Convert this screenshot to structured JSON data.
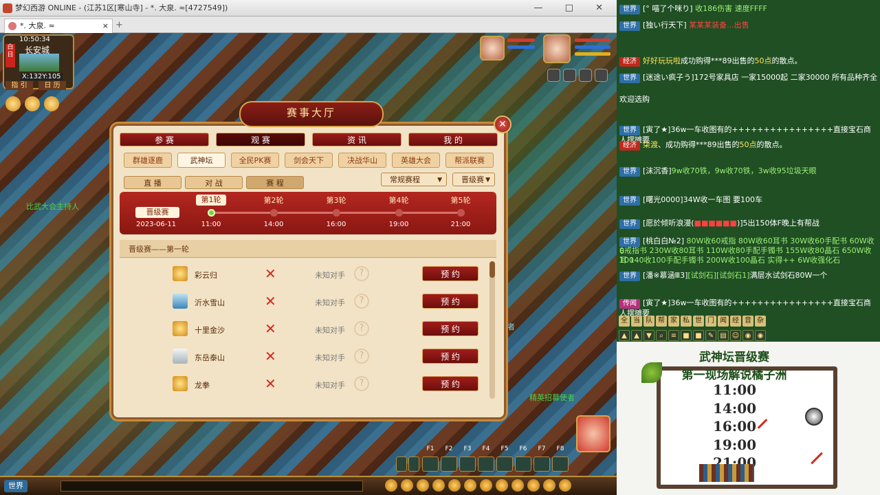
{
  "window": {
    "title": "梦幻西游 ONLINE - (江苏1区[寒山寺] - *. 大泉. ≈[4727549])",
    "controls": "— □ ✕"
  },
  "tab": {
    "title": "*. 大泉. ≈",
    "close": "×",
    "new": "+"
  },
  "minimap": {
    "time": "10:50:34",
    "city": "长安城",
    "coord": "X:132Y:105",
    "day": "白日",
    "guide": "指 引",
    "calendar": "日 历"
  },
  "npc_names": [
    "比武大会主持人",
    "精英招募使者",
    "者"
  ],
  "panel": {
    "title": "赛事大厅",
    "close": "✕",
    "main_tabs": [
      "参 赛",
      "观 赛",
      "资 讯",
      "我 的"
    ],
    "main_selected": 1,
    "sub_tabs": [
      "群雄逐鹿",
      "武神坛",
      "全民PK赛",
      "剑会天下",
      "决战华山",
      "英雄大会",
      "帮派联赛"
    ],
    "sub_selected": 1,
    "view_tabs": [
      "直 播",
      "对 战",
      "赛 程"
    ],
    "view_selected": 2,
    "dropdown_type": "常规赛程",
    "dropdown_stage": "晋级赛",
    "timeline": {
      "label": "晋级赛",
      "date": "2023-06-11",
      "rounds": [
        "第1轮",
        "第2轮",
        "第3轮",
        "第4轮",
        "第5轮"
      ],
      "times": [
        "11:00",
        "14:00",
        "16:00",
        "19:00",
        "21:00"
      ],
      "selected": 0
    },
    "section_title": "晋级赛——第一轮",
    "matches": [
      {
        "server": "彩云归",
        "icon": "dream-icon",
        "opponent": "未知对手",
        "action": "预 约"
      },
      {
        "server": "沂水雪山",
        "icon": "mountain-icon",
        "opponent": "未知对手",
        "action": "预 约"
      },
      {
        "server": "十里金沙",
        "icon": "dream-icon",
        "opponent": "未知对手",
        "action": "预 约"
      },
      {
        "server": "东岳泰山",
        "icon": "snow-mountain-icon",
        "opponent": "未知对手",
        "action": "预 约"
      },
      {
        "server": "龙拳",
        "icon": "dream-icon",
        "opponent": "未知对手",
        "action": "预 约"
      }
    ],
    "unknown_mark": "?",
    "vs_mark": "✕"
  },
  "hotkeys": [
    "F1",
    "F2",
    "F3",
    "F4",
    "F5",
    "F6",
    "F7",
    "F8"
  ],
  "chatbar": {
    "channel": "世界"
  },
  "chat": [
    {
      "tag": "世界",
      "kind": "world",
      "parts": [
        {
          "t": "[° 喵了个咪り] ",
          "c": ""
        },
        {
          "t": "收186伤害 速度FFFF",
          "c": "g"
        }
      ]
    },
    {
      "tag": "世界",
      "kind": "world",
      "parts": [
        {
          "t": "[独い行天下] ",
          "c": ""
        },
        {
          "t": "某某某装备...出售",
          "c": "r"
        }
      ]
    },
    {
      "tag": "经济",
      "kind": "eco",
      "parts": [
        {
          "t": "",
          "c": ""
        },
        {
          "t": "好好玩玩啦",
          "c": "y"
        },
        {
          "t": "成功购得***89出售的",
          "c": ""
        },
        {
          "t": "50点",
          "c": "y"
        },
        {
          "t": "的散点。",
          "c": ""
        }
      ]
    },
    {
      "tag": "世界",
      "kind": "world",
      "parts": [
        {
          "t": "[迷途い疯子う]172号家具店 一家15000起 二家30000 所有品种齐全",
          "c": ""
        }
      ]
    },
    {
      "tag": "",
      "kind": "none",
      "parts": [
        {
          "t": "欢迎选购",
          "c": ""
        }
      ]
    },
    {
      "tag": "世界",
      "kind": "world",
      "parts": [
        {
          "t": "[寅了★]36w一车收图有的++++++++++++++++直接宝石商人摆摊要",
          "c": ""
        }
      ]
    },
    {
      "tag": "经济",
      "kind": "eco",
      "parts": [
        {
          "t": "柒渡",
          "c": "y"
        },
        {
          "t": "、成功购得***89出售的",
          "c": ""
        },
        {
          "t": "50点",
          "c": "y"
        },
        {
          "t": "的散点。",
          "c": ""
        }
      ]
    },
    {
      "tag": "世界",
      "kind": "world",
      "parts": [
        {
          "t": "[沫沉香]",
          "c": ""
        },
        {
          "t": "9w收70铁，9w收70铁，3w收95垃圾天眼",
          "c": "g"
        }
      ]
    },
    {
      "tag": "世界",
      "kind": "world",
      "parts": [
        {
          "t": "[曙光0000]34W收一车图 要100车",
          "c": ""
        }
      ]
    },
    {
      "tag": "世界",
      "kind": "world",
      "parts": [
        {
          "t": "[愿於倾听浪漫(",
          "c": ""
        },
        {
          "t": "■■■■■■",
          "c": "r"
        },
        {
          "t": ")]5出150体F晚上有帮战",
          "c": ""
        }
      ]
    },
    {
      "tag": "世界",
      "kind": "world",
      "parts": [
        {
          "t": "[桃白白№2] ",
          "c": ""
        },
        {
          "t": "80W收60戒指 80W收60耳书 30W收60手配书 60W收6",
          "c": "g"
        }
      ]
    },
    {
      "tag": "",
      "kind": "none",
      "parts": [
        {
          "t": "0戒指书 230W收80耳书 110W收80手配手镯书 155W收80晶石 650W收100",
          "c": "g"
        }
      ]
    },
    {
      "tag": "",
      "kind": "none",
      "parts": [
        {
          "t": "耳 140收100手配手镯书 200W收100晶石 实得++ 6W收强化石",
          "c": "g"
        }
      ]
    },
    {
      "tag": "世界",
      "kind": "world",
      "parts": [
        {
          "t": "[潘※慕涵Ⅲ3]",
          "c": ""
        },
        {
          "t": "[试剑石][试剑石1]",
          "c": "g"
        },
        {
          "t": "满层水试剑石80W一个",
          "c": ""
        }
      ]
    },
    {
      "tag": "传闻",
      "kind": "rumor",
      "parts": [
        {
          "t": "[寅了★]36w一车收图有的++++++++++++++++直接宝石商人摆摊要",
          "c": ""
        }
      ]
    }
  ],
  "chat_toolbar": [
    "全",
    "当",
    "队",
    "帮",
    "家",
    "私",
    "世",
    "门",
    "闻",
    "经",
    "音",
    "杂"
  ],
  "board": {
    "title": "武神坛晋级赛",
    "subtitle": "第一现场解说橘子洲",
    "times": [
      "11:00",
      "14:00",
      "16:00",
      "19:00",
      "21:00"
    ]
  }
}
